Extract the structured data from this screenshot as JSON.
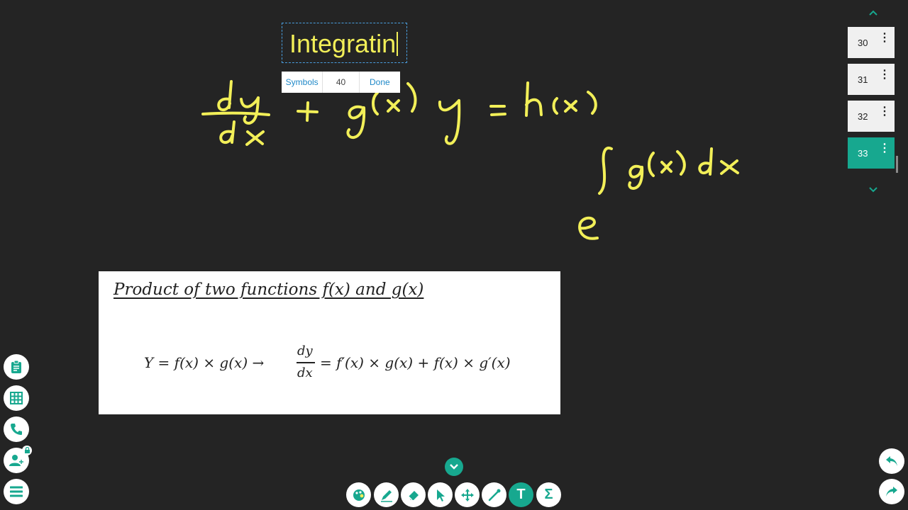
{
  "text_editor": {
    "content": "Integratin",
    "symbols_label": "Symbols",
    "font_size": "40",
    "done_label": "Done"
  },
  "image_card": {
    "heading": "Product of two functions f(x) and g(x)",
    "formula_left": "Y = f(x) × g(x) →",
    "fraction_numerator": "dy",
    "fraction_denominator": "dx",
    "formula_right": "= f′(x) × g(x) + f(x) × g′(x)"
  },
  "pages": {
    "items": [
      {
        "number": "30",
        "active": false
      },
      {
        "number": "31",
        "active": false
      },
      {
        "number": "32",
        "active": false
      },
      {
        "number": "33",
        "active": true
      }
    ],
    "menu_glyph": "⋮"
  },
  "left_tools": [
    "clipboard-icon",
    "grid-icon",
    "phone-icon",
    "add-user-icon",
    "menu-icon"
  ],
  "bottom_tools": [
    "palette-icon",
    "pen-icon",
    "eraser-icon",
    "pointer-icon",
    "move-icon",
    "laser-icon",
    "text-icon",
    "sigma-icon"
  ],
  "text_tool_label": "T",
  "sigma_label": "Σ",
  "colors": {
    "board": "#242424",
    "ink": "#f2ef58",
    "accent": "#17a88f",
    "link": "#1e88c8"
  }
}
